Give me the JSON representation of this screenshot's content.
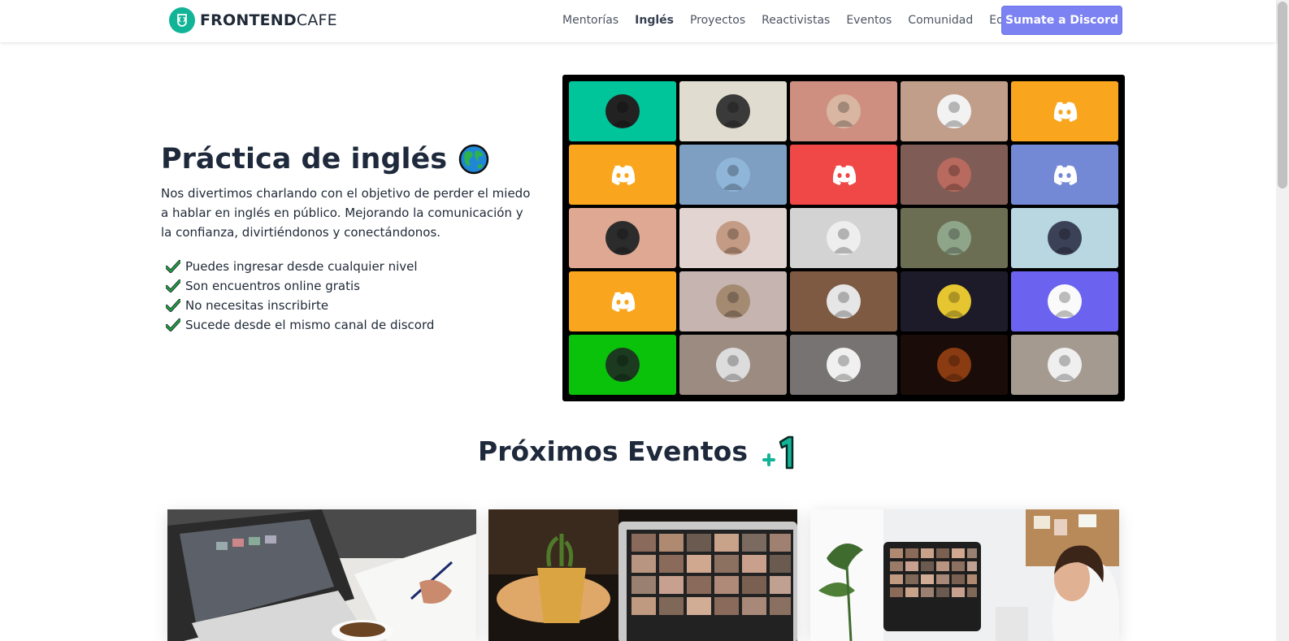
{
  "nav": {
    "logo_bold": "FRONTEND",
    "logo_light": "CAFE",
    "links": [
      "Mentorías",
      "Inglés",
      "Proyectos",
      "Reactivistas",
      "Eventos",
      "Comunidad",
      "Equipo"
    ],
    "active_link": "Inglés",
    "cta": "Sumate a Discord"
  },
  "hero": {
    "title": "Práctica de inglés",
    "icon": "globe-icon",
    "description": "Nos divertimos charlando con el objetivo de perder el miedo a hablar en inglés en público. Mejorando la comunicación y la confianza, divirtiéndonos y conectándonos.",
    "features": [
      "Puedes ingresar desde cualquier nivel",
      "Son encuentros online gratis",
      "No necesitas inscribirte",
      "Sucede desde el mismo canal de discord"
    ]
  },
  "video_grid": {
    "tiles": [
      {
        "bg": "#00c49a",
        "kind": "avatar",
        "av": "#222222"
      },
      {
        "bg": "#e0ddd0",
        "kind": "avatar",
        "av": "#3a3a3a"
      },
      {
        "bg": "#cf8f80",
        "kind": "avatar",
        "av": "#d8b6a2"
      },
      {
        "bg": "#c19e8a",
        "kind": "avatar",
        "av": "#f2f2f2"
      },
      {
        "bg": "#f9a61e",
        "kind": "discord"
      },
      {
        "bg": "#f9a61e",
        "kind": "discord"
      },
      {
        "bg": "#7f9fc2",
        "kind": "avatar",
        "av": "#8fb5d8"
      },
      {
        "bg": "#f04747",
        "kind": "discord"
      },
      {
        "bg": "#7f5d56",
        "kind": "avatar",
        "av": "#b86a5e"
      },
      {
        "bg": "#7489d6",
        "kind": "discord"
      },
      {
        "bg": "#dfa892",
        "kind": "avatar",
        "av": "#2c2c2c"
      },
      {
        "bg": "#e2d4d0",
        "kind": "avatar",
        "av": "#c49b85"
      },
      {
        "bg": "#d3d3d3",
        "kind": "avatar",
        "av": "#eeeeee"
      },
      {
        "bg": "#6b6e52",
        "kind": "avatar",
        "av": "#8fa58a"
      },
      {
        "bg": "#b8d7e0",
        "kind": "avatar",
        "av": "#3b4156"
      },
      {
        "bg": "#f9a61e",
        "kind": "discord"
      },
      {
        "bg": "#c5b4b0",
        "kind": "avatar",
        "av": "#a58a72"
      },
      {
        "bg": "#7d5a41",
        "kind": "avatar",
        "av": "#e6e6e6"
      },
      {
        "bg": "#1d1b2a",
        "kind": "avatar",
        "av": "#e6c630"
      },
      {
        "bg": "#6b63f0",
        "kind": "avatar",
        "av": "#fafafa"
      },
      {
        "bg": "#0bc20b",
        "kind": "avatar",
        "av": "#1b3a1f"
      },
      {
        "bg": "#9c8b80",
        "kind": "avatar",
        "av": "#dcdcdc"
      },
      {
        "bg": "#777372",
        "kind": "avatar",
        "av": "#f0f0f0"
      },
      {
        "bg": "#1a0c08",
        "kind": "avatar",
        "av": "#8a3b12"
      },
      {
        "bg": "#a59a90",
        "kind": "avatar",
        "av": "#efefef"
      }
    ]
  },
  "events": {
    "title": "Próximos Eventos",
    "icon": "plus-one-icon"
  }
}
